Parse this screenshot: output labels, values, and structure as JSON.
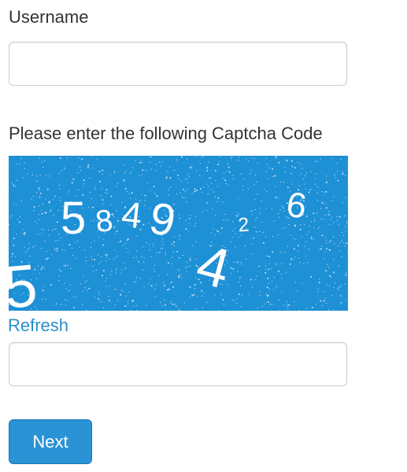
{
  "form": {
    "username_label": "Username",
    "username_value": "",
    "captcha_label": "Please enter the following Captcha Code",
    "captcha_glyphs": [
      "5",
      "8",
      "4",
      "9",
      "2",
      "6",
      "4",
      "5"
    ],
    "refresh_label": "Refresh",
    "captcha_value": "",
    "next_label": "Next"
  },
  "colors": {
    "captcha_background": "#1e90d6",
    "link": "#2a8fc8",
    "button": "#2a93d5",
    "text": "#333333"
  }
}
